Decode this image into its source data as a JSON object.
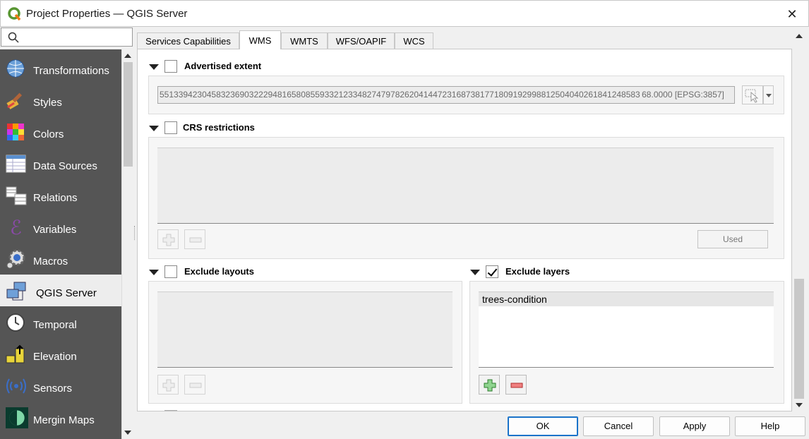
{
  "window": {
    "title": "Project Properties — QGIS Server",
    "close_glyph": "✕"
  },
  "sidebar": {
    "search_placeholder": "",
    "items": [
      {
        "label": "Transformations",
        "icon": "globe-grid-icon"
      },
      {
        "label": "Styles",
        "icon": "paintbrush-icon"
      },
      {
        "label": "Colors",
        "icon": "color-grid-icon"
      },
      {
        "label": "Data Sources",
        "icon": "table-icon"
      },
      {
        "label": "Relations",
        "icon": "relations-icon"
      },
      {
        "label": "Variables",
        "icon": "epsilon-icon"
      },
      {
        "label": "Macros",
        "icon": "gear-play-icon"
      },
      {
        "label": "QGIS Server",
        "icon": "server-icon",
        "active": true
      },
      {
        "label": "Temporal",
        "icon": "clock-icon"
      },
      {
        "label": "Elevation",
        "icon": "elevation-icon"
      },
      {
        "label": "Sensors",
        "icon": "sensor-icon"
      },
      {
        "label": "Mergin Maps",
        "icon": "mergin-icon"
      }
    ]
  },
  "tabs": [
    {
      "label": "Services Capabilities"
    },
    {
      "label": "WMS",
      "active": true
    },
    {
      "label": "WMTS"
    },
    {
      "label": "WFS/OAPIF"
    },
    {
      "label": "WCS"
    }
  ],
  "wms": {
    "advertised_extent": {
      "label": "Advertised extent",
      "checked": false,
      "value": "551339423045832369032229481658085593321233482747978262041447231687381771809192998812504040261841248583 68.0000 [EPSG:3857]"
    },
    "crs_restrictions": {
      "label": "CRS restrictions",
      "checked": false,
      "used_button": "Used"
    },
    "exclude_layouts": {
      "label": "Exclude layouts",
      "checked": false
    },
    "exclude_layers": {
      "label": "Exclude layers",
      "checked": true,
      "items": [
        "trees-condition"
      ]
    }
  },
  "buttons": {
    "ok": "OK",
    "cancel": "Cancel",
    "apply": "Apply",
    "help": "Help"
  },
  "colors": {
    "sidebar_bg": "#555555",
    "default_button_border": "#1a73c9",
    "add_green": "#3a9a3a",
    "remove_red": "#d04040"
  }
}
